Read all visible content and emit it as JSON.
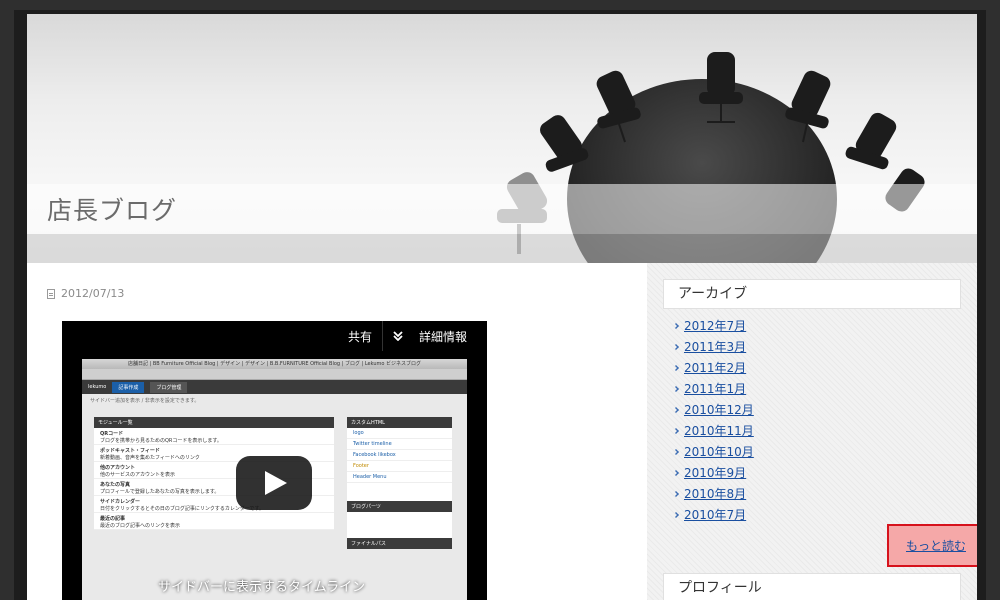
{
  "site": {
    "title": "店長ブログ"
  },
  "post": {
    "date": "2012/07/13",
    "video": {
      "share_label": "共有",
      "info_label": "詳細情報",
      "caption": "サイドバーに表示するタイムライン",
      "window_title": "店舗日記 | BB Furniture Official Blog | デザイン | デザイン | B.B.FURNITURE Official Blog | ブログ | Lekumo ビジネスブログ",
      "nav_brand": "lekumo",
      "nav_post": "記事作成",
      "nav_manage": "ブログ管理",
      "sub_text": "サイドバー追加を表示 / 非表示を設定できます。",
      "module_header": "モジュール一覧",
      "modules": [
        {
          "name": "QRコード",
          "desc": "ブログを携帯から見るためのQRコードを表示します。"
        },
        {
          "name": "ポッドキャスト・フィード",
          "desc": "新着動画、音声を集めたフィードへのリンク"
        },
        {
          "name": "他のアカウント",
          "desc": "他のサービスのアカウントを表示"
        },
        {
          "name": "あなたの写真",
          "desc": "プロフィールで登録したあなたの写真を表示します。"
        },
        {
          "name": "サイドカレンダー",
          "desc": "日付をクリックするとその日のブログ記事にリンクするカレンダーです。"
        },
        {
          "name": "最近の記事",
          "desc": "最近のブログ記事へのリンクを表示"
        }
      ],
      "custom_header": "カスタムHTML",
      "custom_items": [
        "logo",
        "Twitter timeline",
        "Facebook likebox",
        "Footer",
        "Header Menu"
      ],
      "parts_header": "ブログパーツ",
      "permalink_header": "ファイナルパス"
    }
  },
  "sidebar": {
    "archive_title": "アーカイブ",
    "archives": [
      "2012年7月",
      "2011年3月",
      "2011年2月",
      "2011年1月",
      "2010年12月",
      "2010年11月",
      "2010年10月",
      "2010年9月",
      "2010年8月",
      "2010年7月"
    ],
    "more_label": "もっと読む",
    "profile_title": "プロフィール"
  },
  "colors": {
    "link": "#1a4fa0",
    "highlight_fill": "#f5a8a8",
    "highlight_border": "#d6121c"
  }
}
